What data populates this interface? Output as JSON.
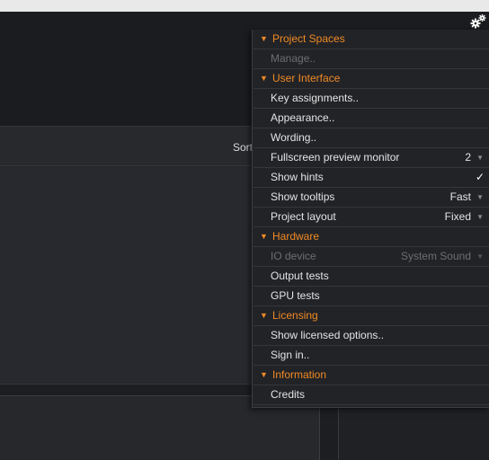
{
  "toolbar": {
    "sort_label": "Sort",
    "settings_icon": "gear-icon"
  },
  "menu": {
    "rows": [
      {
        "type": "header",
        "label": "Project Spaces"
      },
      {
        "type": "item",
        "label": "Manage..",
        "disabled": true
      },
      {
        "type": "header",
        "label": "User Interface"
      },
      {
        "type": "item",
        "label": "Key assignments.."
      },
      {
        "type": "item",
        "label": "Appearance.."
      },
      {
        "type": "item",
        "label": "Wording.."
      },
      {
        "type": "select",
        "label": "Fullscreen preview monitor",
        "value": "2"
      },
      {
        "type": "check",
        "label": "Show hints",
        "checked": true,
        "mark": "✓"
      },
      {
        "type": "select",
        "label": "Show tooltips",
        "value": "Fast"
      },
      {
        "type": "select",
        "label": "Project layout",
        "value": "Fixed"
      },
      {
        "type": "header",
        "label": "Hardware"
      },
      {
        "type": "select",
        "label": "IO device",
        "value": "System Sound",
        "disabled": true
      },
      {
        "type": "item",
        "label": "Output tests"
      },
      {
        "type": "item",
        "label": "GPU tests"
      },
      {
        "type": "header",
        "label": "Licensing"
      },
      {
        "type": "item",
        "label": "Show licensed options.."
      },
      {
        "type": "item",
        "label": "Sign in.."
      },
      {
        "type": "header",
        "label": "Information"
      },
      {
        "type": "item",
        "label": "Credits"
      }
    ]
  }
}
